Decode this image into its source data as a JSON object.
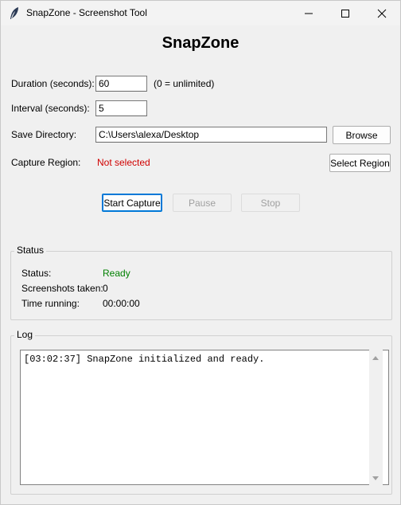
{
  "window": {
    "title": "SnapZone - Screenshot Tool"
  },
  "heading": "SnapZone",
  "form": {
    "duration_label": "Duration (seconds):",
    "duration_value": "60",
    "duration_hint": "(0 = unlimited)",
    "interval_label": "Interval (seconds):",
    "interval_value": "5",
    "directory_label": "Save Directory:",
    "directory_value": "C:\\Users\\alexa/Desktop",
    "browse_label": "Browse",
    "region_label": "Capture Region:",
    "region_value": "Not selected",
    "region_value_color": "#d00000",
    "select_region_label": "Select Region"
  },
  "controls": {
    "start_label": "Start Capture",
    "pause_label": "Pause",
    "stop_label": "Stop"
  },
  "status": {
    "group_title": "Status",
    "status_label": "Status:",
    "status_value": "Ready",
    "status_color": "#008000",
    "shots_label": "Screenshots taken:",
    "shots_value": "0",
    "time_label": "Time running:",
    "time_value": "00:00:00"
  },
  "log": {
    "group_title": "Log",
    "lines": [
      "[03:02:37] SnapZone initialized and ready."
    ]
  },
  "icons": {
    "app": "feather-icon",
    "minimize": "minimize-icon",
    "maximize": "maximize-icon",
    "close": "close-icon"
  }
}
